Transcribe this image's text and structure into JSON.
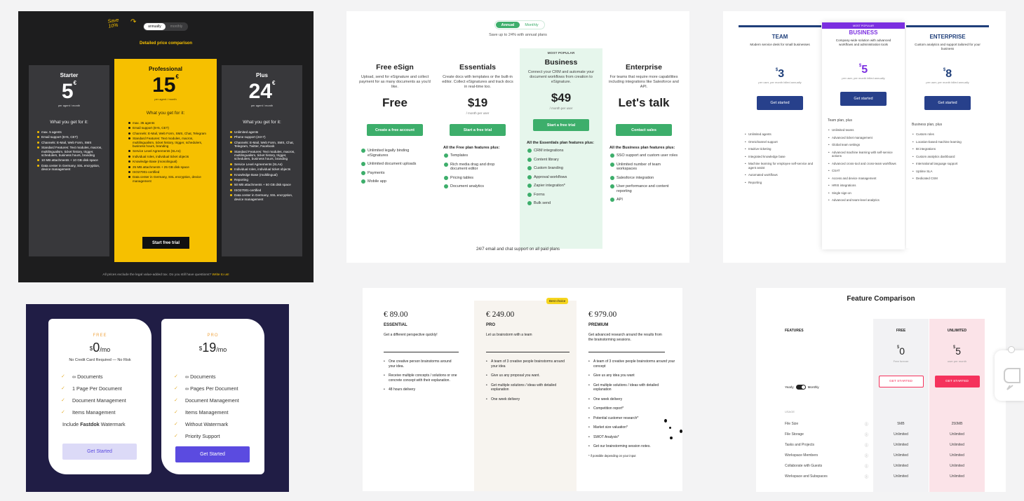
{
  "card1": {
    "save_note": "Save 10%",
    "toggle": [
      "annually",
      "monthly"
    ],
    "link": "Detailed price comparison",
    "what_you_get": "What you get for it:",
    "cta": "Start free trial",
    "footer": "All prices exclude the legal value-added tax. Do you still have questions?",
    "footer_link": "Write to us!",
    "plans": [
      {
        "name": "Starter",
        "price": "5",
        "currency": "€",
        "unit": "per agent / month",
        "features": [
          "max. 5 agents",
          "Email support (8×5, CET)",
          "Channels: E-Mail, Web Form, SMS",
          "Standard Features: Text modules, macros, multilingualism, ticket history, trigger, schedulers, business hours, branding",
          "10 MB attachments + 10 GB disk space",
          "Data center in Germany, SSL encryption, device management"
        ]
      },
      {
        "name": "Professional",
        "price": "15",
        "currency": "€",
        "unit": "per agent / month",
        "features": [
          "max. 35 agents",
          "Email support (8×5, CET)",
          "Channels: E-Mail, Web Form, SMS, Chat, Telegram",
          "Standard Features: Text modules, macros, multilingualism, ticket history, trigger, schedulers, business hours, branding",
          "Service Level Agreements (SLAs)",
          "Individual roles, individual ticket objects",
          "Knowledge Base (monolingual)",
          "25 MB attachments + 25 GB disk space",
          "ISO27001-certified",
          "Data center in Germany, SSL encryption, device management"
        ]
      },
      {
        "name": "Plus",
        "price": "24",
        "currency": "€",
        "unit": "per agent / month",
        "features": [
          "Unlimited agents",
          "Phone support (24×7)",
          "Channels: E-Mail, Web Form, SMS, Chat, Telegram, Twitter, Facebook",
          "Standard Features: Text modules, macros, multilingualism, ticket history, trigger, schedulers, business hours, branding",
          "Service Level Agreements (SLAs)",
          "Individual roles, individual ticket objects",
          "Knowledge Base (multilingual)",
          "Reporting",
          "50 MB attachments + 50 GB disk space",
          "ISO27001-certified",
          "Data center in Germany, SSL encryption, device management"
        ]
      }
    ]
  },
  "card2": {
    "toggle": [
      "Annual",
      "Monthly"
    ],
    "save_note": "Save up to 24% with annual plans",
    "popular": "MOST POPULAR",
    "footer": "24/7 email and chat support on all paid plans",
    "plans": [
      {
        "name": "Free eSign",
        "desc": "Upload, send for eSignature and collect payment for as many documents as you'd like.",
        "price": "Free",
        "unit": "",
        "cta": "Create a free account",
        "header": "",
        "features": [
          "Unlimited legally binding eSignatures",
          "Unlimited document uploads",
          "Payments",
          "Mobile app"
        ]
      },
      {
        "name": "Essentials",
        "desc": "Create docs with templates or the built-in editor. Collect eSignatures and track docs in real-time too.",
        "price": "$19",
        "unit": "/ month per user",
        "cta": "Start a free trial",
        "header": "All the Free plan features plus:",
        "features": [
          "Templates",
          "Rich media drag and drop document editor",
          "Pricing tables",
          "Document analytics"
        ]
      },
      {
        "name": "Business",
        "desc": "Connect your CRM and automate your document workflows from creation to eSignature.",
        "price": "$49",
        "unit": "/ month per user",
        "cta": "Start a free trial",
        "header": "All the Essentials plan features plus:",
        "features": [
          "CRM integrations",
          "Content library",
          "Custom branding",
          "Approval workflows",
          "Zapier integration*",
          "Forms",
          "Bulk send"
        ]
      },
      {
        "name": "Enterprise",
        "desc": "For teams that require more capabilities including integrations like Salesforce and API.",
        "price": "Let's talk",
        "unit": "",
        "cta": "Contact sales",
        "header": "All the Business plan features plus:",
        "features": [
          "SSO support and custom user roles",
          "Unlimited number of team workspaces",
          "Salesforce integration",
          "User performance and content reporting",
          "API"
        ]
      }
    ]
  },
  "card3": {
    "popular": "MOST POPULAR",
    "tiers": [
      {
        "name": "TEAM",
        "desc": "Modern service desk for small businesses",
        "price": "3",
        "currency": "$",
        "unit": "per user, per month billed annually",
        "cta": "Get started",
        "header": "",
        "features": [
          "Unlimited agents",
          "Omnichannel support",
          "Intuitive ticketing",
          "Integrated knowledge base",
          "Machine learning for employee self-service and agent assist",
          "Automated workflows",
          "Reporting"
        ]
      },
      {
        "name": "BUSINESS",
        "desc": "Company-wide solution with advanced workflows and administration tools",
        "price": "5",
        "currency": "$",
        "unit": "per user, per month billed annually",
        "cta": "Get started",
        "header": "Team plan, plus",
        "features": [
          "Unlimited teams",
          "Advanced ticket management",
          "Global team settings",
          "Advanced machine learning with self-service actions",
          "Advanced cross-tool and cross-team workflows",
          "CSAT",
          "Access and device management",
          "HRIS integrations",
          "Single sign-on",
          "Advanced and team-level analytics"
        ]
      },
      {
        "name": "ENTERPRISE",
        "desc": "Custom analytics and support tailored for your business",
        "price": "8",
        "currency": "$",
        "unit": "per user, per month billed annually",
        "cta": "Get started",
        "header": "Business plan, plus",
        "features": [
          "Custom roles",
          "Location-based machine learning",
          "BI integrations",
          "Custom analytics dashboard",
          "International language support",
          "Uptime SLA",
          "Dedicated CSM"
        ]
      }
    ]
  },
  "card4": {
    "plans": [
      {
        "tag": "FREE",
        "currency": "$",
        "price": "0",
        "period": "/mo",
        "note": "No Credit Card Required — No Risk",
        "features": [
          "∞ Documents",
          "1 Page Per Document",
          "Document Management",
          "Items Management"
        ],
        "extra": "Include",
        "extra_bold": "Fastdok",
        "extra_tail": "Watermark",
        "cta": "Get Started"
      },
      {
        "tag": "PRO",
        "currency": "$",
        "price": "19",
        "period": "/mo",
        "note": "",
        "features": [
          "∞ Documents",
          "∞ Pages Per Document",
          "Document Management",
          "Items Management",
          "Without Watermark",
          "Priority Support"
        ],
        "cta": "Get Started"
      }
    ]
  },
  "card5": {
    "best": "Best choice",
    "footnote": "* if possible depending on your input",
    "plans": [
      {
        "price": "€ 89.00",
        "name": "ESSENTIAL",
        "desc": "Get a different perspective quickly!",
        "features": [
          "One creative person brainstorms around your idea.",
          "Receive multiple concepts / solutions or one concrete concept with their explanation.",
          "48 hours delivery"
        ]
      },
      {
        "price": "€ 249.00",
        "name": "PRO",
        "desc": "Let us brainstorm with a team",
        "features": [
          "A team of 3 creative people brainstorms around your idea",
          "Give us any proposal you want.",
          "Get multiple solutions / ideas with detailed explanation",
          "One week delivery"
        ]
      },
      {
        "price": "€ 979.00",
        "name": "PREMIUM",
        "desc": "Get advanced research around the results from the brainstorming sessions.",
        "features": [
          "A team of 3 creative people brainstorms around your concept",
          "Give us any idea you want",
          "Get multiple solutions / ideas with detailed explanation",
          "One week delivery",
          "Competition report*",
          "Potential customer research*",
          "Market size valuation*",
          "SWOT Analysis*",
          "Get our brainstorming session notes."
        ]
      }
    ]
  },
  "card6": {
    "title": "Feature Comparison",
    "features_label": "FEATURES",
    "toggle": [
      "Yearly",
      "Monthly"
    ],
    "usage": "USAGE",
    "plans": [
      {
        "name": "FREE",
        "price": "0",
        "currency": "$",
        "sub": "Free forever",
        "cta": "GET STARTED"
      },
      {
        "name": "UNLIMITED",
        "price": "5",
        "currency": "$",
        "sub": "user per month",
        "cta": "GET STARTED"
      }
    ],
    "rows": [
      {
        "label": "File Size",
        "free": "5MB",
        "unl": "250MB"
      },
      {
        "label": "File Storage",
        "free": "Unlimited",
        "unl": "Unlimited"
      },
      {
        "label": "Tasks and Projects",
        "free": "Unlimited",
        "unl": "Unlimited"
      },
      {
        "label": "Workspace Members",
        "free": "Unlimited",
        "unl": "Unlimited"
      },
      {
        "label": "Collaborate with Guests",
        "free": "Unlimited",
        "unl": "Unlimited"
      },
      {
        "label": "Workspace and Subspaces",
        "free": "Unlimited",
        "unl": "Unlimited"
      }
    ]
  },
  "colors": {
    "yellow": "#f6c000",
    "green": "#3dae6b",
    "navy": "#27408b",
    "purple": "#7b2fe0",
    "indigo": "#5b4be0",
    "pink": "#f5325c"
  }
}
